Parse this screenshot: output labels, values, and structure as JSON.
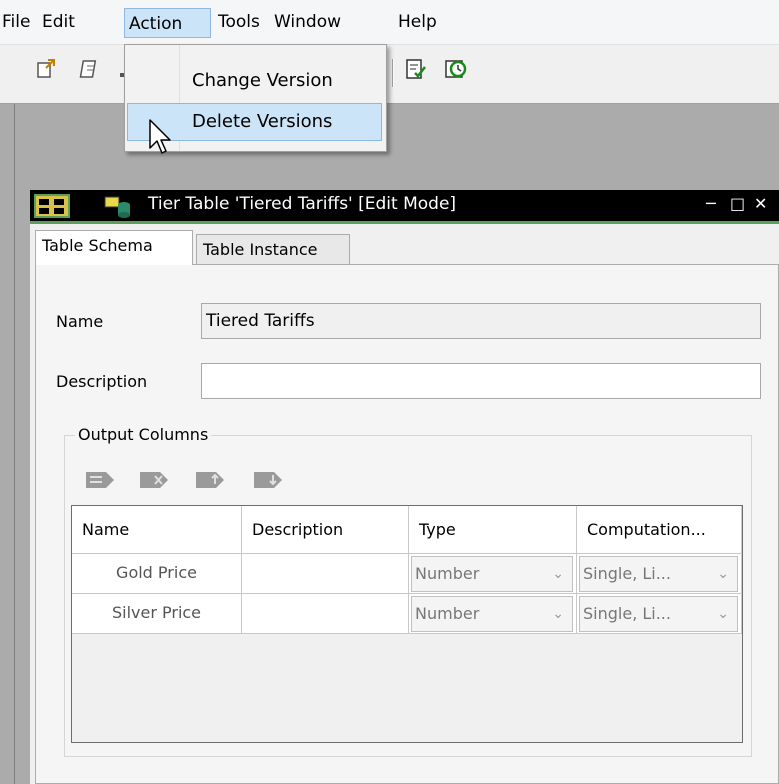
{
  "menubar": {
    "items": [
      "File",
      "Edit",
      "Action",
      "Tools",
      "Window",
      "Help"
    ]
  },
  "action_menu": {
    "items": [
      "Change Version",
      "Delete Versions"
    ]
  },
  "window": {
    "title": "Tier Table 'Tiered Tariffs' [Edit Mode]",
    "controls": [
      "minimize-icon",
      "restore-icon",
      "close-icon"
    ]
  },
  "tabs": [
    "Table Schema",
    "Table Instance"
  ],
  "form": {
    "name_label": "Name",
    "name_value": "Tiered Tariffs",
    "description_label": "Description",
    "description_value": ""
  },
  "output_columns": {
    "legend": "Output Columns",
    "toolbar_icons": [
      "add-column-icon",
      "delete-column-icon",
      "move-up-icon",
      "move-down-icon"
    ],
    "headers": [
      "Name",
      "Description",
      "Type",
      "Computation..."
    ],
    "rows": [
      {
        "name": "Gold Price",
        "description": "",
        "type": "Number",
        "computation": "Single, Li..."
      },
      {
        "name": "Silver Price",
        "description": "",
        "type": "Number",
        "computation": "Single, Li..."
      }
    ]
  },
  "colors": {
    "menu_highlight": "#cce4f7",
    "title_bar": "#000000",
    "title_accent": "#5aa05a",
    "mdi_background": "#ababab"
  }
}
